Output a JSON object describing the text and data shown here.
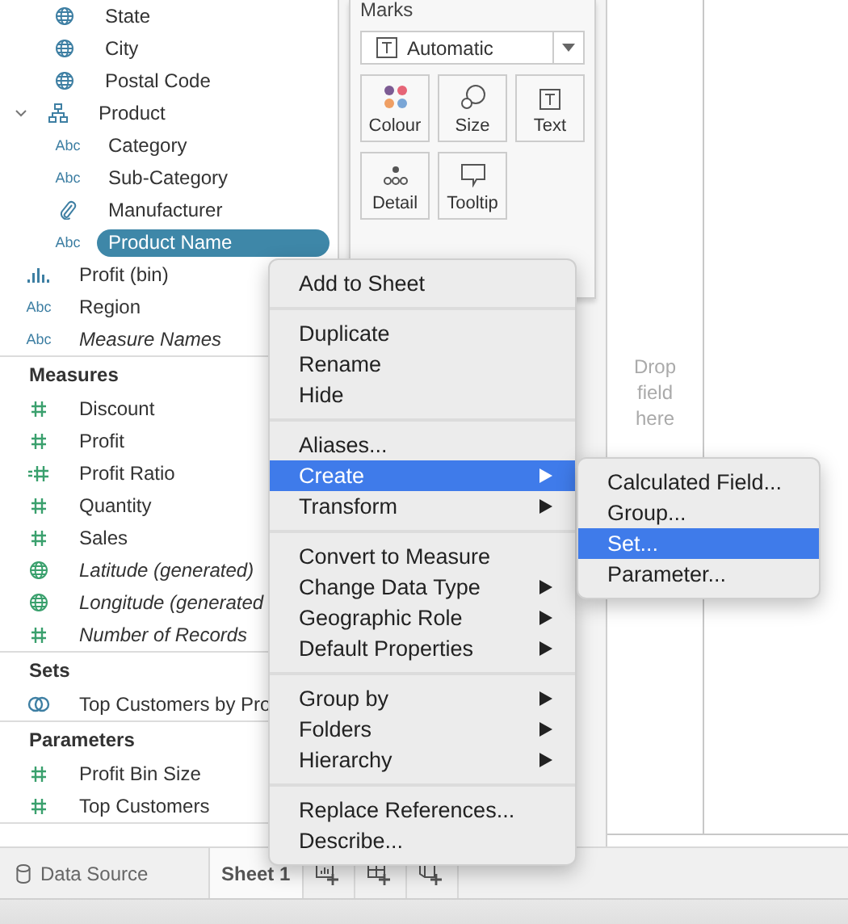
{
  "data_pane": {
    "dimensions": {
      "scrolled_group_children": [
        {
          "label": "State",
          "kind": "geo",
          "generated": false,
          "selected": false
        },
        {
          "label": "City",
          "kind": "geo",
          "generated": false,
          "selected": false
        },
        {
          "label": "Postal Code",
          "kind": "geo",
          "generated": false,
          "selected": false
        }
      ],
      "items": [
        {
          "label": "Product",
          "kind": "hierarchy",
          "generated": false,
          "selected": false,
          "expanded": true,
          "children": [
            {
              "label": "Category",
              "kind": "string",
              "type_label": "Abc",
              "generated": false,
              "selected": false
            },
            {
              "label": "Sub-Category",
              "kind": "string",
              "type_label": "Abc",
              "generated": false,
              "selected": false
            },
            {
              "label": "Manufacturer",
              "kind": "group",
              "generated": false,
              "selected": false
            },
            {
              "label": "Product Name",
              "kind": "string",
              "type_label": "Abc",
              "generated": false,
              "selected": true
            }
          ]
        },
        {
          "label": "Profit (bin)",
          "kind": "bin",
          "generated": false,
          "selected": false
        },
        {
          "label": "Region",
          "kind": "string",
          "type_label": "Abc",
          "generated": false,
          "selected": false
        },
        {
          "label": "Measure Names",
          "kind": "string",
          "type_label": "Abc",
          "generated": true,
          "selected": false
        }
      ]
    },
    "measures": {
      "title": "Measures",
      "items": [
        {
          "label": "Discount",
          "kind": "number",
          "generated": false,
          "selected": false
        },
        {
          "label": "Profit",
          "kind": "number",
          "generated": false,
          "selected": false
        },
        {
          "label": "Profit Ratio",
          "kind": "calculated",
          "generated": false,
          "selected": false
        },
        {
          "label": "Quantity",
          "kind": "number",
          "generated": false,
          "selected": false
        },
        {
          "label": "Sales",
          "kind": "number",
          "generated": false,
          "selected": false
        },
        {
          "label": "Latitude (generated)",
          "kind": "geo",
          "generated": true,
          "selected": false
        },
        {
          "label": "Longitude (generated",
          "kind": "geo",
          "generated": true,
          "selected": false
        },
        {
          "label": "Number of Records",
          "kind": "number",
          "generated": true,
          "selected": false
        }
      ]
    },
    "sets": {
      "title": "Sets",
      "items": [
        {
          "label": "Top Customers by Pro",
          "kind": "set",
          "generated": false,
          "selected": false
        }
      ]
    },
    "parameters": {
      "title": "Parameters",
      "items": [
        {
          "label": "Profit Bin Size",
          "kind": "number",
          "generated": false,
          "selected": false
        },
        {
          "label": "Top Customers",
          "kind": "number",
          "generated": false,
          "selected": false
        }
      ]
    }
  },
  "marks": {
    "title": "Marks",
    "mark_type": "Automatic",
    "buttons": [
      {
        "label": "Colour",
        "kind": "colour"
      },
      {
        "label": "Size",
        "kind": "size"
      },
      {
        "label": "Text",
        "kind": "text"
      },
      {
        "label": "Detail",
        "kind": "detail"
      },
      {
        "label": "Tooltip",
        "kind": "tooltip"
      }
    ]
  },
  "canvas": {
    "drop_hint": "Drop field here"
  },
  "context_menu": {
    "groups": [
      [
        {
          "label": "Add to Sheet",
          "submenu": false,
          "selected": false
        }
      ],
      [
        {
          "label": "Duplicate",
          "submenu": false,
          "selected": false
        },
        {
          "label": "Rename",
          "submenu": false,
          "selected": false
        },
        {
          "label": "Hide",
          "submenu": false,
          "selected": false
        }
      ],
      [
        {
          "label": "Aliases...",
          "submenu": false,
          "selected": false
        },
        {
          "label": "Create",
          "submenu": true,
          "selected": true
        },
        {
          "label": "Transform",
          "submenu": true,
          "selected": false
        }
      ],
      [
        {
          "label": "Convert to Measure",
          "submenu": false,
          "selected": false
        },
        {
          "label": "Change Data Type",
          "submenu": true,
          "selected": false
        },
        {
          "label": "Geographic Role",
          "submenu": true,
          "selected": false
        },
        {
          "label": "Default Properties",
          "submenu": true,
          "selected": false
        }
      ],
      [
        {
          "label": "Group by",
          "submenu": true,
          "selected": false
        },
        {
          "label": "Folders",
          "submenu": true,
          "selected": false
        },
        {
          "label": "Hierarchy",
          "submenu": true,
          "selected": false
        }
      ],
      [
        {
          "label": "Replace References...",
          "submenu": false,
          "selected": false
        },
        {
          "label": "Describe...",
          "submenu": false,
          "selected": false
        }
      ]
    ],
    "submenu": [
      {
        "label": "Calculated Field...",
        "selected": false
      },
      {
        "label": "Group...",
        "selected": false
      },
      {
        "label": "Set...",
        "selected": true
      },
      {
        "label": "Parameter...",
        "selected": false
      }
    ]
  },
  "bottom_tabs": [
    {
      "label": "Data Source",
      "kind": "datasource",
      "selected": false
    },
    {
      "label": "Sheet 1",
      "kind": "sheet",
      "selected": true
    }
  ]
}
